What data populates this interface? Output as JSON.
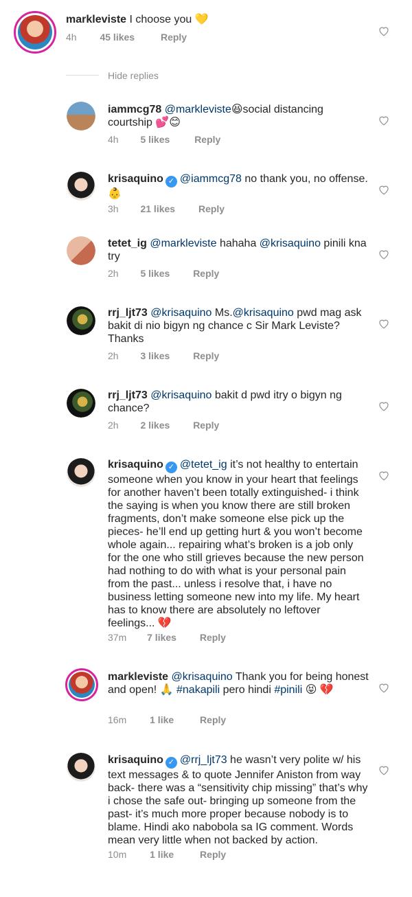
{
  "top_comment": {
    "username": "markleviste",
    "text": "I choose you 💛",
    "time": "4h",
    "likes": "45 likes",
    "reply": "Reply"
  },
  "hide_replies": "Hide replies",
  "replies": [
    {
      "username": "iammcg78",
      "mention": "@markleviste",
      "text": "😆social distancing courtship 💕😊",
      "time": "4h",
      "likes": "5 likes",
      "reply": "Reply"
    },
    {
      "username": "krisaquino",
      "mention": "@iammcg78",
      "text": " no thank you, no offense. 👶",
      "time": "3h",
      "likes": "21 likes",
      "reply": "Reply"
    },
    {
      "username": "tetet_ig",
      "mention": "@markleviste",
      "text_a": "  hahaha ",
      "mention2": "@krisaquino",
      "text_b": " pinili kna try",
      "time": "2h",
      "likes": "5 likes",
      "reply": "Reply"
    },
    {
      "username": "rrj_ljt73",
      "mention": "@krisaquino",
      "text_a": " Ms.",
      "mention2": "@krisaquino",
      "text_b": " pwd mag ask bakit di nio bigyn ng chance c Sir Mark Leviste? Thanks",
      "time": "2h",
      "likes": "3 likes",
      "reply": "Reply"
    },
    {
      "username": "rrj_ljt73",
      "mention": "@krisaquino",
      "text": " bakit d pwd itry o bigyn ng chance?",
      "time": "2h",
      "likes": "2 likes",
      "reply": "Reply"
    },
    {
      "username": "krisaquino",
      "mention": "@tetet_ig",
      "text": " it’s not healthy to entertain someone when you know in your heart that feelings for another haven’t been totally extinguished- i think the saying is when you know there are still broken fragments, don’t make someone else pick up the pieces- he’ll end up getting hurt & you won’t become whole again... repairing what’s broken is a job only for the one who still grieves because the new person had nothing to do with what is your personal pain from the past... unless i resolve that, i have no business letting someone new into my life. My heart has to know there are absolutely no leftover feelings... 💔",
      "time": "37m",
      "likes": "7 likes",
      "reply": "Reply"
    },
    {
      "username": "markleviste",
      "mention": "@krisaquino",
      "text_a": " Thank you for being honest and open! 🙏 ",
      "tag1": "#nakapili",
      "text_b": " pero hindi ",
      "tag2": "#pinili",
      "text_c": " 😝 💔",
      "time": "16m",
      "likes": "1 like",
      "reply": "Reply"
    },
    {
      "username": "krisaquino",
      "mention": "@rrj_ljt73",
      "text": " he wasn’t very polite w/ his text messages & to quote Jennifer Aniston from way back- there was a “sensitivity chip missing” that’s why i chose the safe out- bringing up someone from the past- it’s much more proper because nobody is to blame. Hindi ako nabobola sa IG comment. Words mean very little when not backed by action.",
      "time": "10m",
      "likes": "1 like",
      "reply": "Reply"
    }
  ],
  "colors": {
    "mention": "#00376b",
    "meta": "#8e8e8e",
    "verified": "#3897f0",
    "story_ring": "#d6249f"
  },
  "icons": {
    "like": "heart-outline-icon",
    "verified": "verified-badge-icon"
  }
}
